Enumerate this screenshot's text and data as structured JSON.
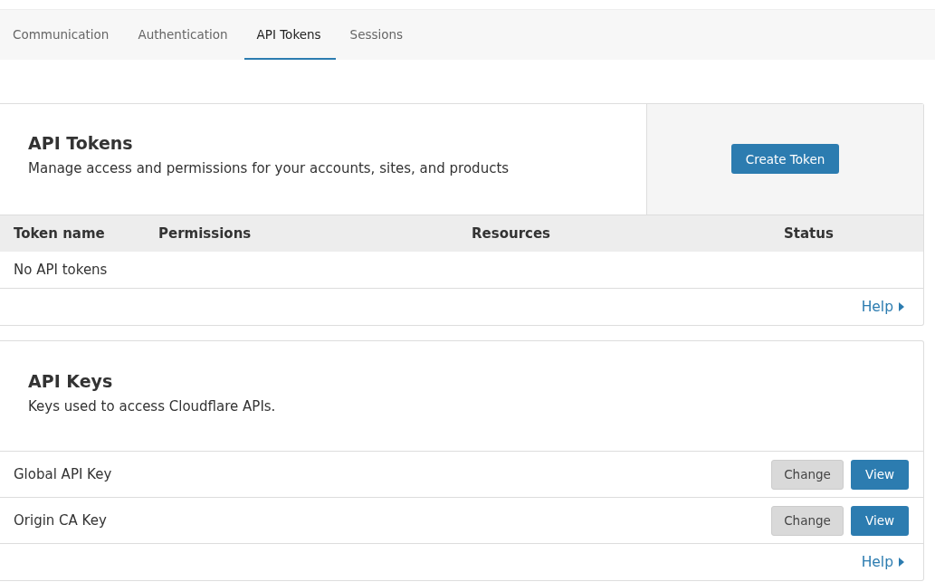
{
  "tabs": [
    {
      "label": "Communication",
      "selected": false
    },
    {
      "label": "Authentication",
      "selected": false
    },
    {
      "label": "API Tokens",
      "selected": true
    },
    {
      "label": "Sessions",
      "selected": false
    }
  ],
  "api_tokens": {
    "title": "API Tokens",
    "description": "Manage access and permissions for your accounts, sites, and products",
    "create_button": "Create Token",
    "columns": [
      "Token name",
      "Permissions",
      "Resources",
      "Status"
    ],
    "empty_message": "No API tokens",
    "help_link": "Help"
  },
  "api_keys": {
    "title": "API Keys",
    "description": "Keys used to access Cloudflare APIs.",
    "rows": [
      {
        "name": "Global API Key",
        "buttons": [
          "Change",
          "View"
        ]
      },
      {
        "name": "Origin CA Key",
        "buttons": [
          "Change",
          "View"
        ]
      }
    ],
    "help_link": "Help"
  }
}
